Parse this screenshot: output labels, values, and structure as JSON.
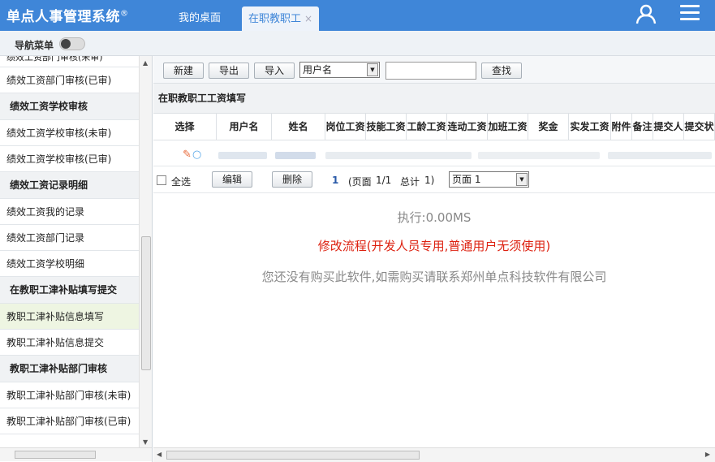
{
  "header": {
    "app_title": "单点人事管理系统",
    "registered_mark": "®",
    "tabs": [
      {
        "label": "我的桌面"
      },
      {
        "label": "在职教职工",
        "close": "×"
      }
    ]
  },
  "subbar": {
    "nav_label": "导航菜单"
  },
  "sidebar": {
    "items": [
      {
        "label": "绩效工资部门审核(未审)",
        "type": "partial"
      },
      {
        "label": "绩效工资部门审核(已审)",
        "type": "item"
      },
      {
        "label": "绩效工资学校审核",
        "type": "group"
      },
      {
        "label": "绩效工资学校审核(未审)",
        "type": "item"
      },
      {
        "label": "绩效工资学校审核(已审)",
        "type": "item"
      },
      {
        "label": "绩效工资记录明细",
        "type": "group"
      },
      {
        "label": "绩效工资我的记录",
        "type": "item"
      },
      {
        "label": "绩效工资部门记录",
        "type": "item"
      },
      {
        "label": "绩效工资学校明细",
        "type": "item"
      },
      {
        "label": "在教职工津补贴填写提交",
        "type": "group"
      },
      {
        "label": "教职工津补贴信息填写",
        "type": "selected"
      },
      {
        "label": "教职工津补贴信息提交",
        "type": "item"
      },
      {
        "label": "教职工津补贴部门审核",
        "type": "group"
      },
      {
        "label": "教职工津补贴部门审核(未审)",
        "type": "item"
      },
      {
        "label": "教职工津补贴部门审核(已审)",
        "type": "item"
      }
    ]
  },
  "toolbar": {
    "new_label": "新建",
    "export_label": "导出",
    "import_label": "导入",
    "field_select": "用户名",
    "search_label": "查找"
  },
  "grid": {
    "title": "在职教职工工资填写",
    "columns": [
      {
        "label": "选择",
        "w": 78
      },
      {
        "label": "用户名",
        "w": 68
      },
      {
        "label": "姓名",
        "w": 66
      },
      {
        "label": "岗位工资",
        "w": 50
      },
      {
        "label": "技能工资",
        "w": 50
      },
      {
        "label": "工龄工资",
        "w": 50
      },
      {
        "label": "连动工资",
        "w": 50
      },
      {
        "label": "加班工资",
        "w": 50
      },
      {
        "label": "奖金",
        "w": 50
      },
      {
        "label": "实发工资",
        "w": 52
      },
      {
        "label": "附件",
        "w": 26
      },
      {
        "label": "备注",
        "w": 26
      },
      {
        "label": "提交人",
        "w": 38
      },
      {
        "label": "提交状",
        "w": 38
      }
    ]
  },
  "pager": {
    "select_all": "全选",
    "edit_label": "编辑",
    "delete_label": "删除",
    "current_page": "1",
    "page_prefix": "(页面",
    "page_of": "1/1",
    "total_label": "总计",
    "total_value": "1)",
    "page_select": "页面 1"
  },
  "messages": {
    "exec": "执行:0.00MS",
    "flow": "修改流程(开发人员专用,普通用户无须使用)",
    "buy": "您还没有购买此软件,如需购买请联系郑州单点科技软件有限公司"
  },
  "colors": {
    "header_bg": "#3f86d8",
    "flow_text": "#dd2211"
  }
}
